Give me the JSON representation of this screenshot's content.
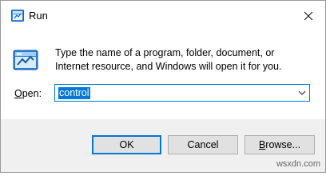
{
  "window": {
    "title": "Run"
  },
  "body": {
    "description": "Type the name of a program, folder, document, or Internet resource, and Windows will open it for you.",
    "open_label_underlined": "O",
    "open_label_rest": "pen:",
    "input_value": "control"
  },
  "buttons": {
    "ok": "OK",
    "cancel": "Cancel",
    "browse_underlined": "B",
    "browse_rest": "rowse..."
  },
  "watermark": "wsxdn.com",
  "colors": {
    "accent": "#0078d7",
    "footer_bg": "#f0f0f0",
    "button_bg": "#e1e1e1"
  },
  "icons": [
    "run-app-icon",
    "close-icon",
    "chevron-down-icon",
    "run-program-icon"
  ]
}
